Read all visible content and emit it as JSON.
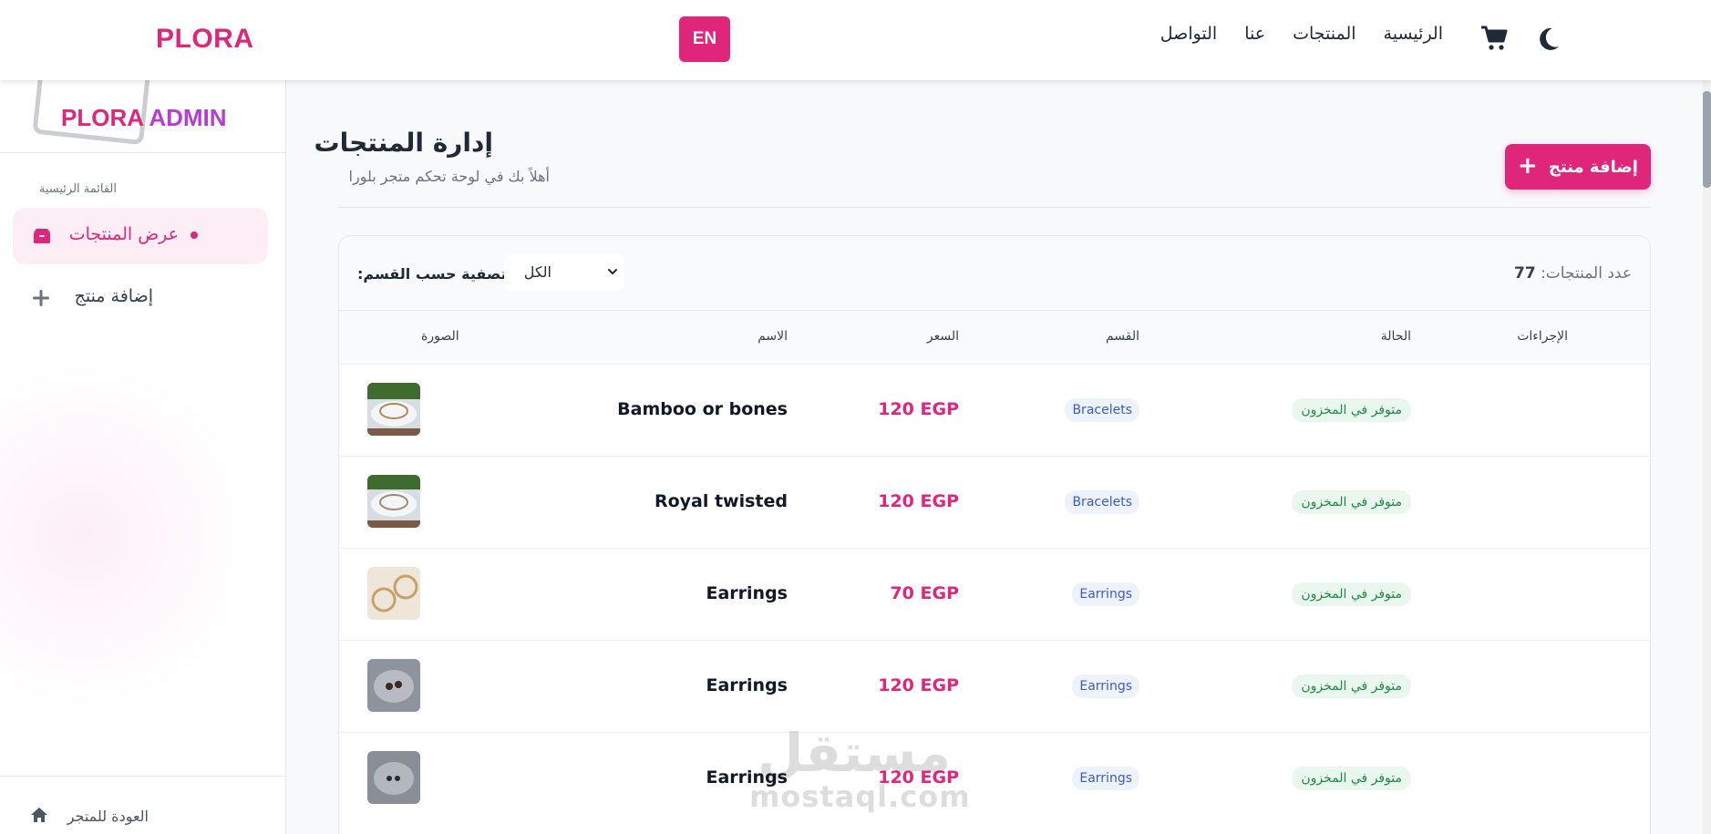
{
  "nav": {
    "brand": "PLORA",
    "lang_button": "EN",
    "links": [
      "الرئيسية",
      "المنتجات",
      "عنا",
      "التواصل"
    ],
    "icons": [
      "cart-icon",
      "moon-icon"
    ]
  },
  "sidebar": {
    "title_main": "PLORA",
    "title_admin": "ADMIN",
    "section_label": "القائمة الرئيسية",
    "items": [
      {
        "label": "عرض المنتجات",
        "icon": "box-icon",
        "active": true
      },
      {
        "label": "إضافة منتج",
        "icon": "plus-icon",
        "active": false
      }
    ],
    "back_link": "العودة للمتجر"
  },
  "main": {
    "title": "إدارة المنتجات",
    "subtitle": "أهلاً بك في لوحة تحكم متجر بلورا",
    "add_button": "إضافة منتج",
    "count_label": "عدد المنتجات:",
    "count_value": "77",
    "filter_label": ":تصفية حسب القسم",
    "filter_value": "الكل",
    "columns": {
      "image": "الصورة",
      "name": "الاسم",
      "price": "السعر",
      "category": "القسم",
      "status": "الحالة",
      "actions": "الإجراءات"
    },
    "rows": [
      {
        "name": "Bamboo or bones",
        "price": "120 EGP",
        "category": "Bracelets",
        "status": "متوفر في المخزون"
      },
      {
        "name": "Royal twisted",
        "price": "120 EGP",
        "category": "Bracelets",
        "status": "متوفر في المخزون"
      },
      {
        "name": "Earrings",
        "price": "70 EGP",
        "category": "Earrings",
        "status": "متوفر في المخزون"
      },
      {
        "name": "Earrings",
        "price": "120 EGP",
        "category": "Earrings",
        "status": "متوفر في المخزون"
      },
      {
        "name": "Earrings",
        "price": "120 EGP",
        "category": "Earrings",
        "status": "متوفر في المخزون"
      }
    ]
  },
  "watermark": {
    "arabic": "مستقل",
    "latin": "mostaql.com"
  },
  "colors": {
    "accent": "#e0267a",
    "admin": "#b83bd6",
    "category_text": "#3b5bc7",
    "status_text": "#1f8a45"
  }
}
